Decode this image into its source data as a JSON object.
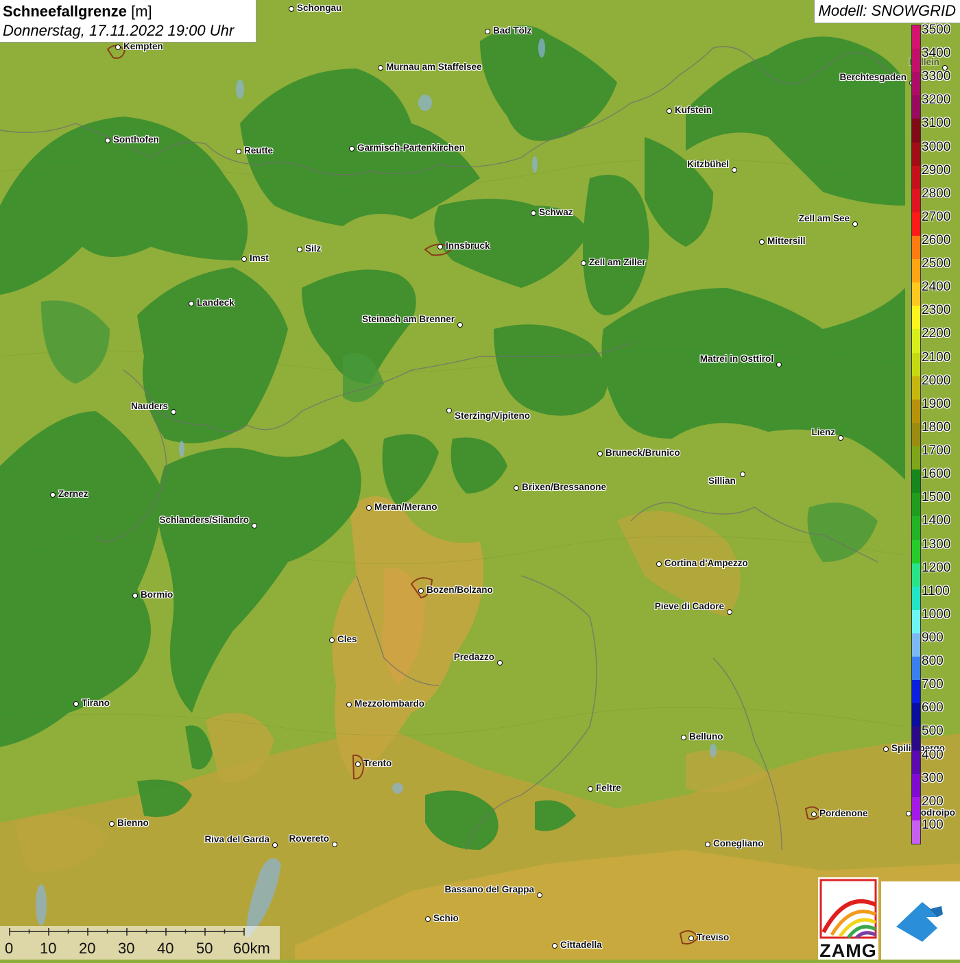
{
  "header": {
    "title_bold": "Schneefallgrenze",
    "title_unit": "[m]",
    "subtitle": "Donnerstag, 17.11.2022 19:00 Uhr"
  },
  "model": {
    "label": "Modell: SNOWGRID"
  },
  "legend": {
    "values": [
      "3500",
      "3400",
      "3300",
      "3200",
      "3100",
      "3000",
      "2900",
      "2800",
      "2700",
      "2600",
      "2500",
      "2400",
      "2300",
      "2200",
      "2100",
      "2000",
      "1900",
      "1800",
      "1700",
      "1600",
      "1500",
      "1400",
      "1300",
      "1200",
      "1100",
      "1000",
      "900",
      "800",
      "700",
      "600",
      "500",
      "400",
      "300",
      "200",
      "100"
    ],
    "colors": [
      "#d4136e",
      "#c2106a",
      "#ae0d66",
      "#980a5f",
      "#7f0b18",
      "#a10e15",
      "#c4111b",
      "#e01420",
      "#ff1a1a",
      "#ff7b12",
      "#ffa514",
      "#ffc820",
      "#fff31c",
      "#d7ef1c",
      "#c6da14",
      "#c7b510",
      "#b8920a",
      "#9b8b10",
      "#7fa61a",
      "#16861f",
      "#1f9d1f",
      "#22b326",
      "#26cc2c",
      "#29e38a",
      "#22e4c6",
      "#6ff4f4",
      "#7db8f2",
      "#3a7ff0",
      "#0a1fe0",
      "#0a0e9e",
      "#2b0a88",
      "#5a0ab0",
      "#7f0ad2",
      "#a31ae8",
      "#c660f0"
    ]
  },
  "cities": [
    {
      "name": "Schongau"
    },
    {
      "name": "Bad Tölz"
    },
    {
      "name": "Kempten"
    },
    {
      "name": "Murnau am Staffelsee"
    },
    {
      "name": "Hallein"
    },
    {
      "name": "Berchtesgaden"
    },
    {
      "name": "Kufstein"
    },
    {
      "name": "Sonthofen"
    },
    {
      "name": "Reutte"
    },
    {
      "name": "Garmisch-Partenkirchen"
    },
    {
      "name": "Kitzbühel"
    },
    {
      "name": "Schwaz"
    },
    {
      "name": "Zell am See"
    },
    {
      "name": "Innsbruck"
    },
    {
      "name": "Silz"
    },
    {
      "name": "Mittersill"
    },
    {
      "name": "Imst"
    },
    {
      "name": "Zell am Ziller"
    },
    {
      "name": "Landeck"
    },
    {
      "name": "Steinach am Brenner"
    },
    {
      "name": "Matrei in Osttirol"
    },
    {
      "name": "Nauders"
    },
    {
      "name": "Sterzing/Vipiteno"
    },
    {
      "name": "Lienz"
    },
    {
      "name": "Bruneck/Brunico"
    },
    {
      "name": "Sillian"
    },
    {
      "name": "Brixen/Bressanone"
    },
    {
      "name": "Zernez"
    },
    {
      "name": "Meran/Merano"
    },
    {
      "name": "Schlanders/Silandro"
    },
    {
      "name": "Cortina d'Ampezzo"
    },
    {
      "name": "Bozen/Bolzano"
    },
    {
      "name": "Bormio"
    },
    {
      "name": "Pieve di Cadore"
    },
    {
      "name": "Cles"
    },
    {
      "name": "Predazzo"
    },
    {
      "name": "Tirano"
    },
    {
      "name": "Mezzolombardo"
    },
    {
      "name": "Belluno"
    },
    {
      "name": "Spilimbergo"
    },
    {
      "name": "Trento"
    },
    {
      "name": "Feltre"
    },
    {
      "name": "Pordenone"
    },
    {
      "name": "Codroipo"
    },
    {
      "name": "Bienno"
    },
    {
      "name": "Riva del Garda"
    },
    {
      "name": "Rovereto"
    },
    {
      "name": "Conegliano"
    },
    {
      "name": "Bassano del Grappa"
    },
    {
      "name": "Schio"
    },
    {
      "name": "Treviso"
    },
    {
      "name": "Cittadella"
    }
  ],
  "scale": {
    "ticks": [
      "0",
      "10",
      "20",
      "30",
      "40",
      "50",
      "60km"
    ]
  },
  "logos": {
    "zamg": "ZAMG"
  }
}
